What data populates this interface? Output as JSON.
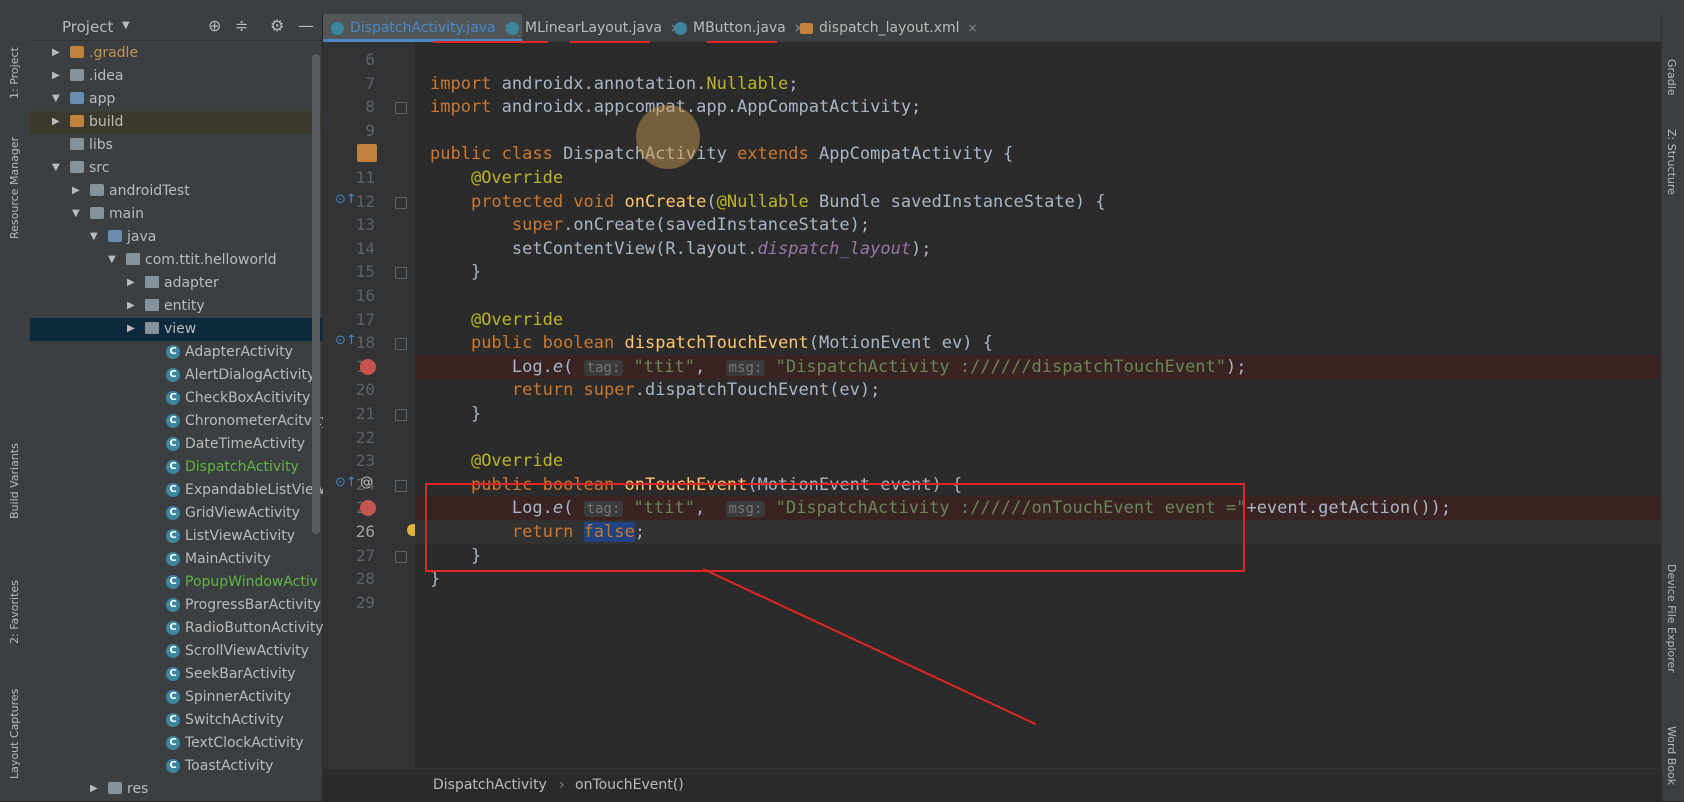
{
  "project_panel": {
    "title": "Project",
    "tree": [
      {
        "label": ".gradle",
        "kind": "folder-orange",
        "arrow": "▶",
        "depth": 1,
        "style": "gradle"
      },
      {
        "label": ".idea",
        "kind": "folder",
        "arrow": "▶",
        "depth": 1
      },
      {
        "label": "app",
        "kind": "folder-blue",
        "arrow": "▼",
        "depth": 1
      },
      {
        "label": "build",
        "kind": "folder-orange",
        "arrow": "▶",
        "depth": 2,
        "style": "hl"
      },
      {
        "label": "libs",
        "kind": "folder",
        "arrow": "",
        "depth": 2
      },
      {
        "label": "src",
        "kind": "folder",
        "arrow": "▼",
        "depth": 2
      },
      {
        "label": "androidTest",
        "kind": "folder",
        "arrow": "▶",
        "depth": 3
      },
      {
        "label": "main",
        "kind": "folder",
        "arrow": "▼",
        "depth": 3
      },
      {
        "label": "java",
        "kind": "folder-blue",
        "arrow": "▼",
        "depth": 4
      },
      {
        "label": "com.ttit.helloworld",
        "kind": "pkg",
        "arrow": "▼",
        "depth": 5
      },
      {
        "label": "adapter",
        "kind": "pkg",
        "arrow": "▶",
        "depth": 6
      },
      {
        "label": "entity",
        "kind": "pkg",
        "arrow": "▶",
        "depth": 6
      },
      {
        "label": "view",
        "kind": "pkg",
        "arrow": "▶",
        "depth": 6,
        "style": "sel"
      },
      {
        "label": "AdapterActivity",
        "kind": "cls",
        "arrow": "",
        "depth": 7
      },
      {
        "label": "AlertDialogActivity",
        "kind": "cls",
        "arrow": "",
        "depth": 7
      },
      {
        "label": "CheckBoxAcitivity",
        "kind": "cls",
        "arrow": "",
        "depth": 7
      },
      {
        "label": "ChronometerAcitvity",
        "kind": "cls",
        "arrow": "",
        "depth": 7
      },
      {
        "label": "DateTimeActivity",
        "kind": "cls",
        "arrow": "",
        "depth": 7
      },
      {
        "label": "DispatchActivity",
        "kind": "cls",
        "arrow": "",
        "depth": 7,
        "style": "green"
      },
      {
        "label": "ExpandableListView",
        "kind": "cls",
        "arrow": "",
        "depth": 7
      },
      {
        "label": "GridViewActivity",
        "kind": "cls",
        "arrow": "",
        "depth": 7
      },
      {
        "label": "ListViewActivity",
        "kind": "cls",
        "arrow": "",
        "depth": 7
      },
      {
        "label": "MainActivity",
        "kind": "cls",
        "arrow": "",
        "depth": 7
      },
      {
        "label": "PopupWindowActiv",
        "kind": "cls",
        "arrow": "",
        "depth": 7,
        "style": "green"
      },
      {
        "label": "ProgressBarActivity",
        "kind": "cls",
        "arrow": "",
        "depth": 7
      },
      {
        "label": "RadioButtonActivity",
        "kind": "cls",
        "arrow": "",
        "depth": 7
      },
      {
        "label": "ScrollViewActivity",
        "kind": "cls",
        "arrow": "",
        "depth": 7
      },
      {
        "label": "SeekBarActivity",
        "kind": "cls",
        "arrow": "",
        "depth": 7
      },
      {
        "label": "SpinnerActivity",
        "kind": "cls",
        "arrow": "",
        "depth": 7
      },
      {
        "label": "SwitchActivity",
        "kind": "cls",
        "arrow": "",
        "depth": 7
      },
      {
        "label": "TextClockActivity",
        "kind": "cls",
        "arrow": "",
        "depth": 7
      },
      {
        "label": "ToastActivity",
        "kind": "cls",
        "arrow": "",
        "depth": 7
      },
      {
        "label": "res",
        "kind": "folder",
        "arrow": "▶",
        "depth": 4
      }
    ]
  },
  "left_tool_tabs": [
    "1: Project",
    "Resource Manager",
    "Build Variants",
    "2: Favorites",
    "Layout Captures"
  ],
  "right_tool_tabs": [
    "Gradle",
    "Z: Structure",
    "Device File Explorer",
    "Word Book"
  ],
  "editor_tabs": [
    {
      "label": "DispatchActivity.java",
      "icon": "class",
      "active": true
    },
    {
      "label": "MLinearLayout.java",
      "icon": "class",
      "active": false
    },
    {
      "label": "MButton.java",
      "icon": "class",
      "active": false
    },
    {
      "label": "dispatch_layout.xml",
      "icon": "xml",
      "active": false
    }
  ],
  "code_lines": [
    {
      "num": "6",
      "html": ""
    },
    {
      "num": "7",
      "html": "<span class='kw'>import</span> androidx.annotation.<span class='ann'>Nullable</span>;"
    },
    {
      "num": "8",
      "html": "<span class='kw'>import</span> androidx.appcompat.app.AppCompatActivity;"
    },
    {
      "num": "9",
      "html": ""
    },
    {
      "num": "10",
      "html": "<span class='kw'>public class</span> DispatchActivity <span class='kw'>extends</span> AppCompatActivity {"
    },
    {
      "num": "11",
      "html": "    <span class='ann'>@Override</span>"
    },
    {
      "num": "12",
      "html": "    <span class='kw'>protected void</span> <span class='fn'>onCreate</span>(<span class='ann'>@Nullable</span> Bundle savedInstanceState) {"
    },
    {
      "num": "13",
      "html": "        <span class='kw'>super</span>.onCreate(savedInstanceState);"
    },
    {
      "num": "14",
      "html": "        setContentView(R.layout.<span class='it'>dispatch_layout</span>);"
    },
    {
      "num": "15",
      "html": "    }"
    },
    {
      "num": "16",
      "html": ""
    },
    {
      "num": "17",
      "html": "    <span class='ann'>@Override</span>"
    },
    {
      "num": "18",
      "html": "    <span class='kw'>public boolean</span> <span class='fn'>dispatchTouchEvent</span>(MotionEvent ev) {"
    },
    {
      "num": "19",
      "html": "        Log.<i>e</i>( <span class='hint'>tag:</span> <span class='str'>\"ttit\"</span>,  <span class='hint'>msg:</span> <span class='str'>\"DispatchActivity ://////dispatchTouchEvent\"</span>);",
      "bp": true
    },
    {
      "num": "20",
      "html": "        <span class='kw'>return super</span>.dispatchTouchEvent(ev);"
    },
    {
      "num": "21",
      "html": "    }"
    },
    {
      "num": "22",
      "html": ""
    },
    {
      "num": "23",
      "html": "    <span class='ann'>@Override</span>"
    },
    {
      "num": "24",
      "html": "    <span class='kw'>public boolean</span> <span class='fn'>onTouchEvent</span>(MotionEvent event) {"
    },
    {
      "num": "25",
      "html": "        Log.<i>e</i>( <span class='hint'>tag:</span> <span class='str'>\"ttit\"</span>,  <span class='hint'>msg:</span> <span class='str'>\"DispatchActivity ://////onTouchEvent event =\"</span>+event.getAction());",
      "bp": true
    },
    {
      "num": "26",
      "html": "        <span class='kw'>return</span> <span class='kw sel-false'>false</span>;",
      "cur": true
    },
    {
      "num": "27",
      "html": "    }"
    },
    {
      "num": "28",
      "html": "}"
    },
    {
      "num": "29",
      "html": ""
    }
  ],
  "breadcrumb": {
    "class_name": "DispatchActivity",
    "separator": "›",
    "method": "onTouchEvent()"
  },
  "colors": {
    "accent": "#4a88c7",
    "annotation_red": "#e02626",
    "breakpoint": "#c75450"
  }
}
